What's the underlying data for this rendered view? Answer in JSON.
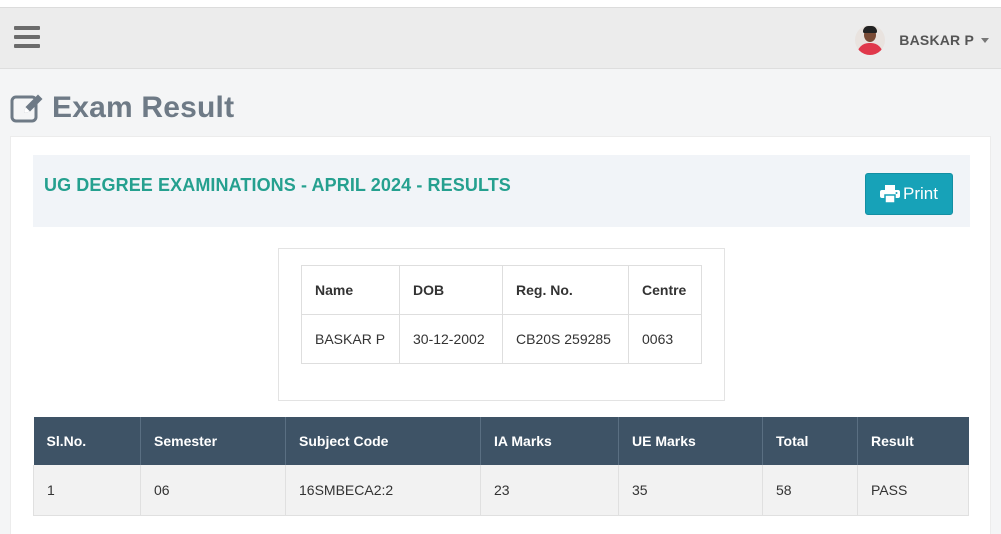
{
  "navbar": {
    "user_name": "BASKAR P"
  },
  "page": {
    "title": "Exam Result"
  },
  "result": {
    "heading": "UG DEGREE EXAMINATIONS - APRIL 2024 - RESULTS",
    "print_label": "Print"
  },
  "student": {
    "headers": [
      "Name",
      "DOB",
      "Reg. No.",
      "Centre"
    ],
    "values": [
      "BASKAR P",
      "30-12-2002",
      "CB20S 259285",
      "0063"
    ]
  },
  "marks": {
    "headers": [
      "Sl.No.",
      "Semester",
      "Subject Code",
      "IA Marks",
      "UE Marks",
      "Total",
      "Result"
    ],
    "rows": [
      [
        "1",
        "06",
        "16SMBECA2:2",
        "23",
        "35",
        "58",
        "PASS"
      ]
    ]
  },
  "colors": {
    "heading_teal": "#25a08f",
    "print_button": "#17a2b8",
    "table_header": "#3e5366",
    "title_gray": "#6e7a86"
  },
  "icons": {
    "menu": "hamburger-icon",
    "title": "edit-icon",
    "print": "printer-icon",
    "user_menu": "caret-down-icon"
  }
}
